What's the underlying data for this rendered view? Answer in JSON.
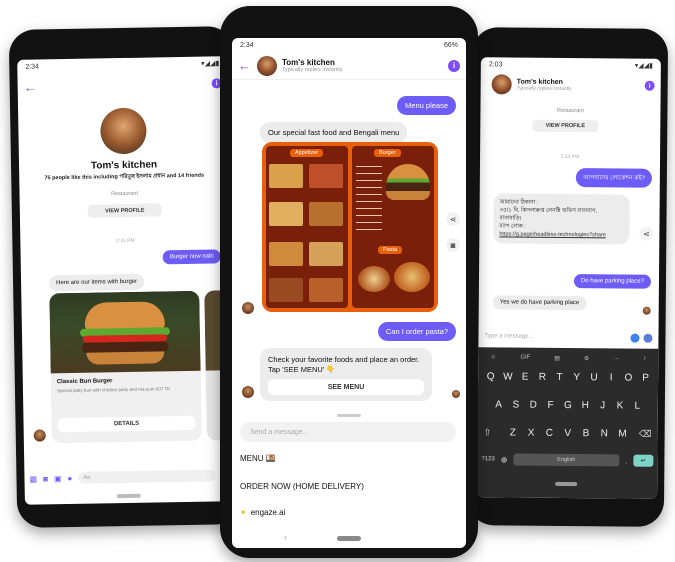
{
  "left_phone": {
    "status_time": "2:34",
    "page_name": "Tom's kitchen",
    "likes_text": "75 people like this including পরিতুষ ইসলাম প্রধান and 14 friends",
    "category": "Restaurant",
    "view_profile": "VIEW PROFILE",
    "timestamp": "2:31 PM",
    "out_msg": "Burger now nabi",
    "in_msg": "Here are our items with burger",
    "card_title": "Classic Bun Burger",
    "card_desc": "Special patty bun with chicken patty and ma-yum 607 TK",
    "card_btn": "DETAILS",
    "input_placeholder": "Aa"
  },
  "center_phone": {
    "status_time": "2:34",
    "status_battery": "66%",
    "page_name": "Tom's kitchen",
    "page_sub": "Typically replies instantly",
    "out_msg_1": "Menu please",
    "in_msg_1": "Our special fast food and Bengali menu",
    "menu_title_1": "Appetizer",
    "menu_title_2": "Burger",
    "menu_title_3": "Pasta",
    "out_msg_2": "Can I order pasta?",
    "in_msg_2": "Check your favorite foods and place an order. Tap 'SEE MENU' 👇",
    "see_menu_btn": "SEE MENU",
    "input_placeholder": "Send a message...",
    "menu_item_1": "MENU 🍱",
    "menu_item_2": "ORDER NOW (HOME DELIVERY)",
    "menu_item_3": "engaze.ai"
  },
  "right_phone": {
    "status_time": "2:03",
    "page_name": "Tom's kitchen",
    "page_sub": "Typically replies instantly",
    "category": "Restaurant",
    "view_profile": "VIEW PROFILE",
    "timestamp": "2:03 PM",
    "out_msg_1": "আপনাদের লোকেশন কই?",
    "in_msg_1_line1": "আমাদের ঠিকানা :",
    "in_msg_1_line2": "৩৫/১ বি, কিসলাক্সপ্ত লেনক্টি অফিস লালবাগ,",
    "in_msg_1_line3": "বাসাবাড়ি।",
    "in_msg_1_line4": "ম্যাপ লোক :",
    "in_msg_1_link": "https://g.page/headless-technologies?share",
    "out_msg_2": "Do have parking place?",
    "in_msg_2": "Yes we do have parking place",
    "input_placeholder": "Type a message...",
    "kb_row1": [
      "Q",
      "W",
      "E",
      "R",
      "T",
      "Y",
      "U",
      "I",
      "O",
      "P"
    ],
    "kb_row2": [
      "A",
      "S",
      "D",
      "F",
      "G",
      "H",
      "J",
      "K",
      "L"
    ],
    "kb_row3": [
      "Z",
      "X",
      "C",
      "V",
      "B",
      "N",
      "M"
    ],
    "kb_space": "English",
    "kb_gif": "GIF",
    "kb_num": "?123"
  },
  "colors": {
    "accent": "#7c4dff",
    "bubble": "#6e5cf6",
    "menu_orange": "#e8600c"
  }
}
